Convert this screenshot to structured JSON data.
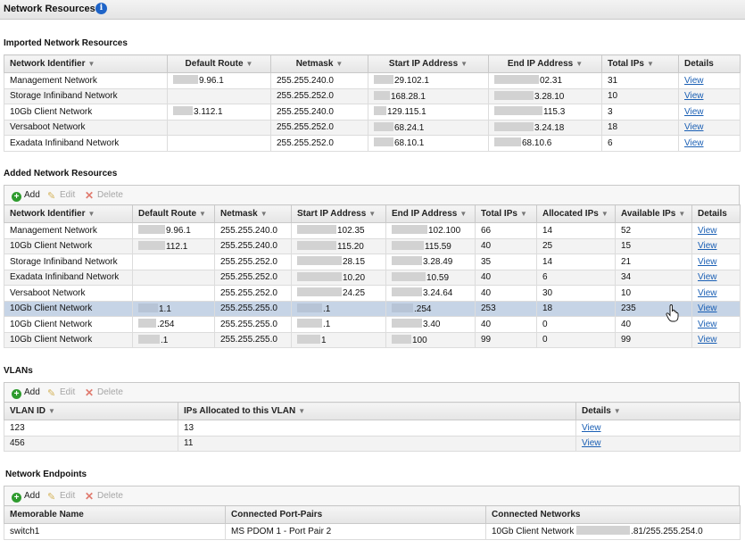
{
  "page": {
    "title": "Network Resources",
    "info_icon": "info-icon"
  },
  "imported": {
    "title": "Imported Network Resources",
    "headers": [
      "Network Identifier",
      "Default Route",
      "Netmask",
      "Start IP Address",
      "End IP Address",
      "Total IPs",
      "Details"
    ],
    "rows": [
      [
        "Management Network",
        "9.96.1",
        "255.255.240.0",
        "29.102.1",
        "02.31",
        "31",
        "View"
      ],
      [
        "Storage Infiniband Network",
        "",
        "255.255.252.0",
        "168.28.1",
        "3.28.10",
        "10",
        "View"
      ],
      [
        "10Gb Client Network",
        "3.112.1",
        "255.255.240.0",
        "129.115.1",
        "115.3",
        "3",
        "View"
      ],
      [
        "Versaboot Network",
        "",
        "255.255.252.0",
        "68.24.1",
        "3.24.18",
        "18",
        "View"
      ],
      [
        "Exadata Infiniband Network",
        "",
        "255.255.252.0",
        "68.10.1",
        "68.10.6",
        "6",
        "View"
      ]
    ]
  },
  "added": {
    "title": "Added Network Resources",
    "toolbar": {
      "add": "Add",
      "edit": "Edit",
      "delete": "Delete"
    },
    "headers": [
      "Network Identifier",
      "Default Route",
      "Netmask",
      "Start IP Address",
      "End IP Address",
      "Total IPs",
      "Allocated IPs",
      "Available IPs",
      "Details"
    ],
    "rows": [
      [
        "Management Network",
        "9.96.1",
        "255.255.240.0",
        "102.35",
        "102.100",
        "66",
        "14",
        "52",
        "View"
      ],
      [
        "10Gb Client Network",
        "112.1",
        "255.255.240.0",
        "115.20",
        "115.59",
        "40",
        "25",
        "15",
        "View"
      ],
      [
        "Storage Infiniband Network",
        "",
        "255.255.252.0",
        "28.15",
        "3.28.49",
        "35",
        "14",
        "21",
        "View"
      ],
      [
        "Exadata Infiniband Network",
        "",
        "255.255.252.0",
        "10.20",
        "10.59",
        "40",
        "6",
        "34",
        "View"
      ],
      [
        "Versaboot Network",
        "",
        "255.255.252.0",
        "24.25",
        "3.24.64",
        "40",
        "30",
        "10",
        "View"
      ],
      [
        "10Gb Client Network",
        "1.1",
        "255.255.255.0",
        ".1",
        ".254",
        "253",
        "18",
        "235",
        "View"
      ],
      [
        "10Gb Client Network",
        ".254",
        "255.255.255.0",
        ".1",
        "3.40",
        "40",
        "0",
        "40",
        "View"
      ],
      [
        "10Gb Client Network",
        ".1",
        "255.255.255.0",
        "1",
        "100",
        "99",
        "0",
        "99",
        "View"
      ]
    ],
    "selected_row": 5
  },
  "vlans": {
    "title": "VLANs",
    "toolbar": {
      "add": "Add",
      "edit": "Edit",
      "delete": "Delete"
    },
    "headers": [
      "VLAN ID",
      "IPs Allocated to this VLAN",
      "Details"
    ],
    "rows": [
      [
        "123",
        "13",
        "View"
      ],
      [
        "456",
        "11",
        "View"
      ]
    ]
  },
  "endpoints": {
    "title": "Network Endpoints",
    "toolbar": {
      "add": "Add",
      "edit": "Edit",
      "delete": "Delete"
    },
    "headers": [
      "Memorable Name",
      "Connected Port-Pairs",
      "Connected Networks"
    ],
    "rows": [
      [
        "switch1",
        "MS PDOM 1 - Port Pair 2",
        "10Gb Client Network",
        ".81/255.255.254.0"
      ]
    ]
  },
  "colors": {
    "selected_row": "#c6d4e6",
    "link": "#1a5fb4",
    "add_icon": "#2e9b2e",
    "info_icon": "#1f64c8"
  }
}
